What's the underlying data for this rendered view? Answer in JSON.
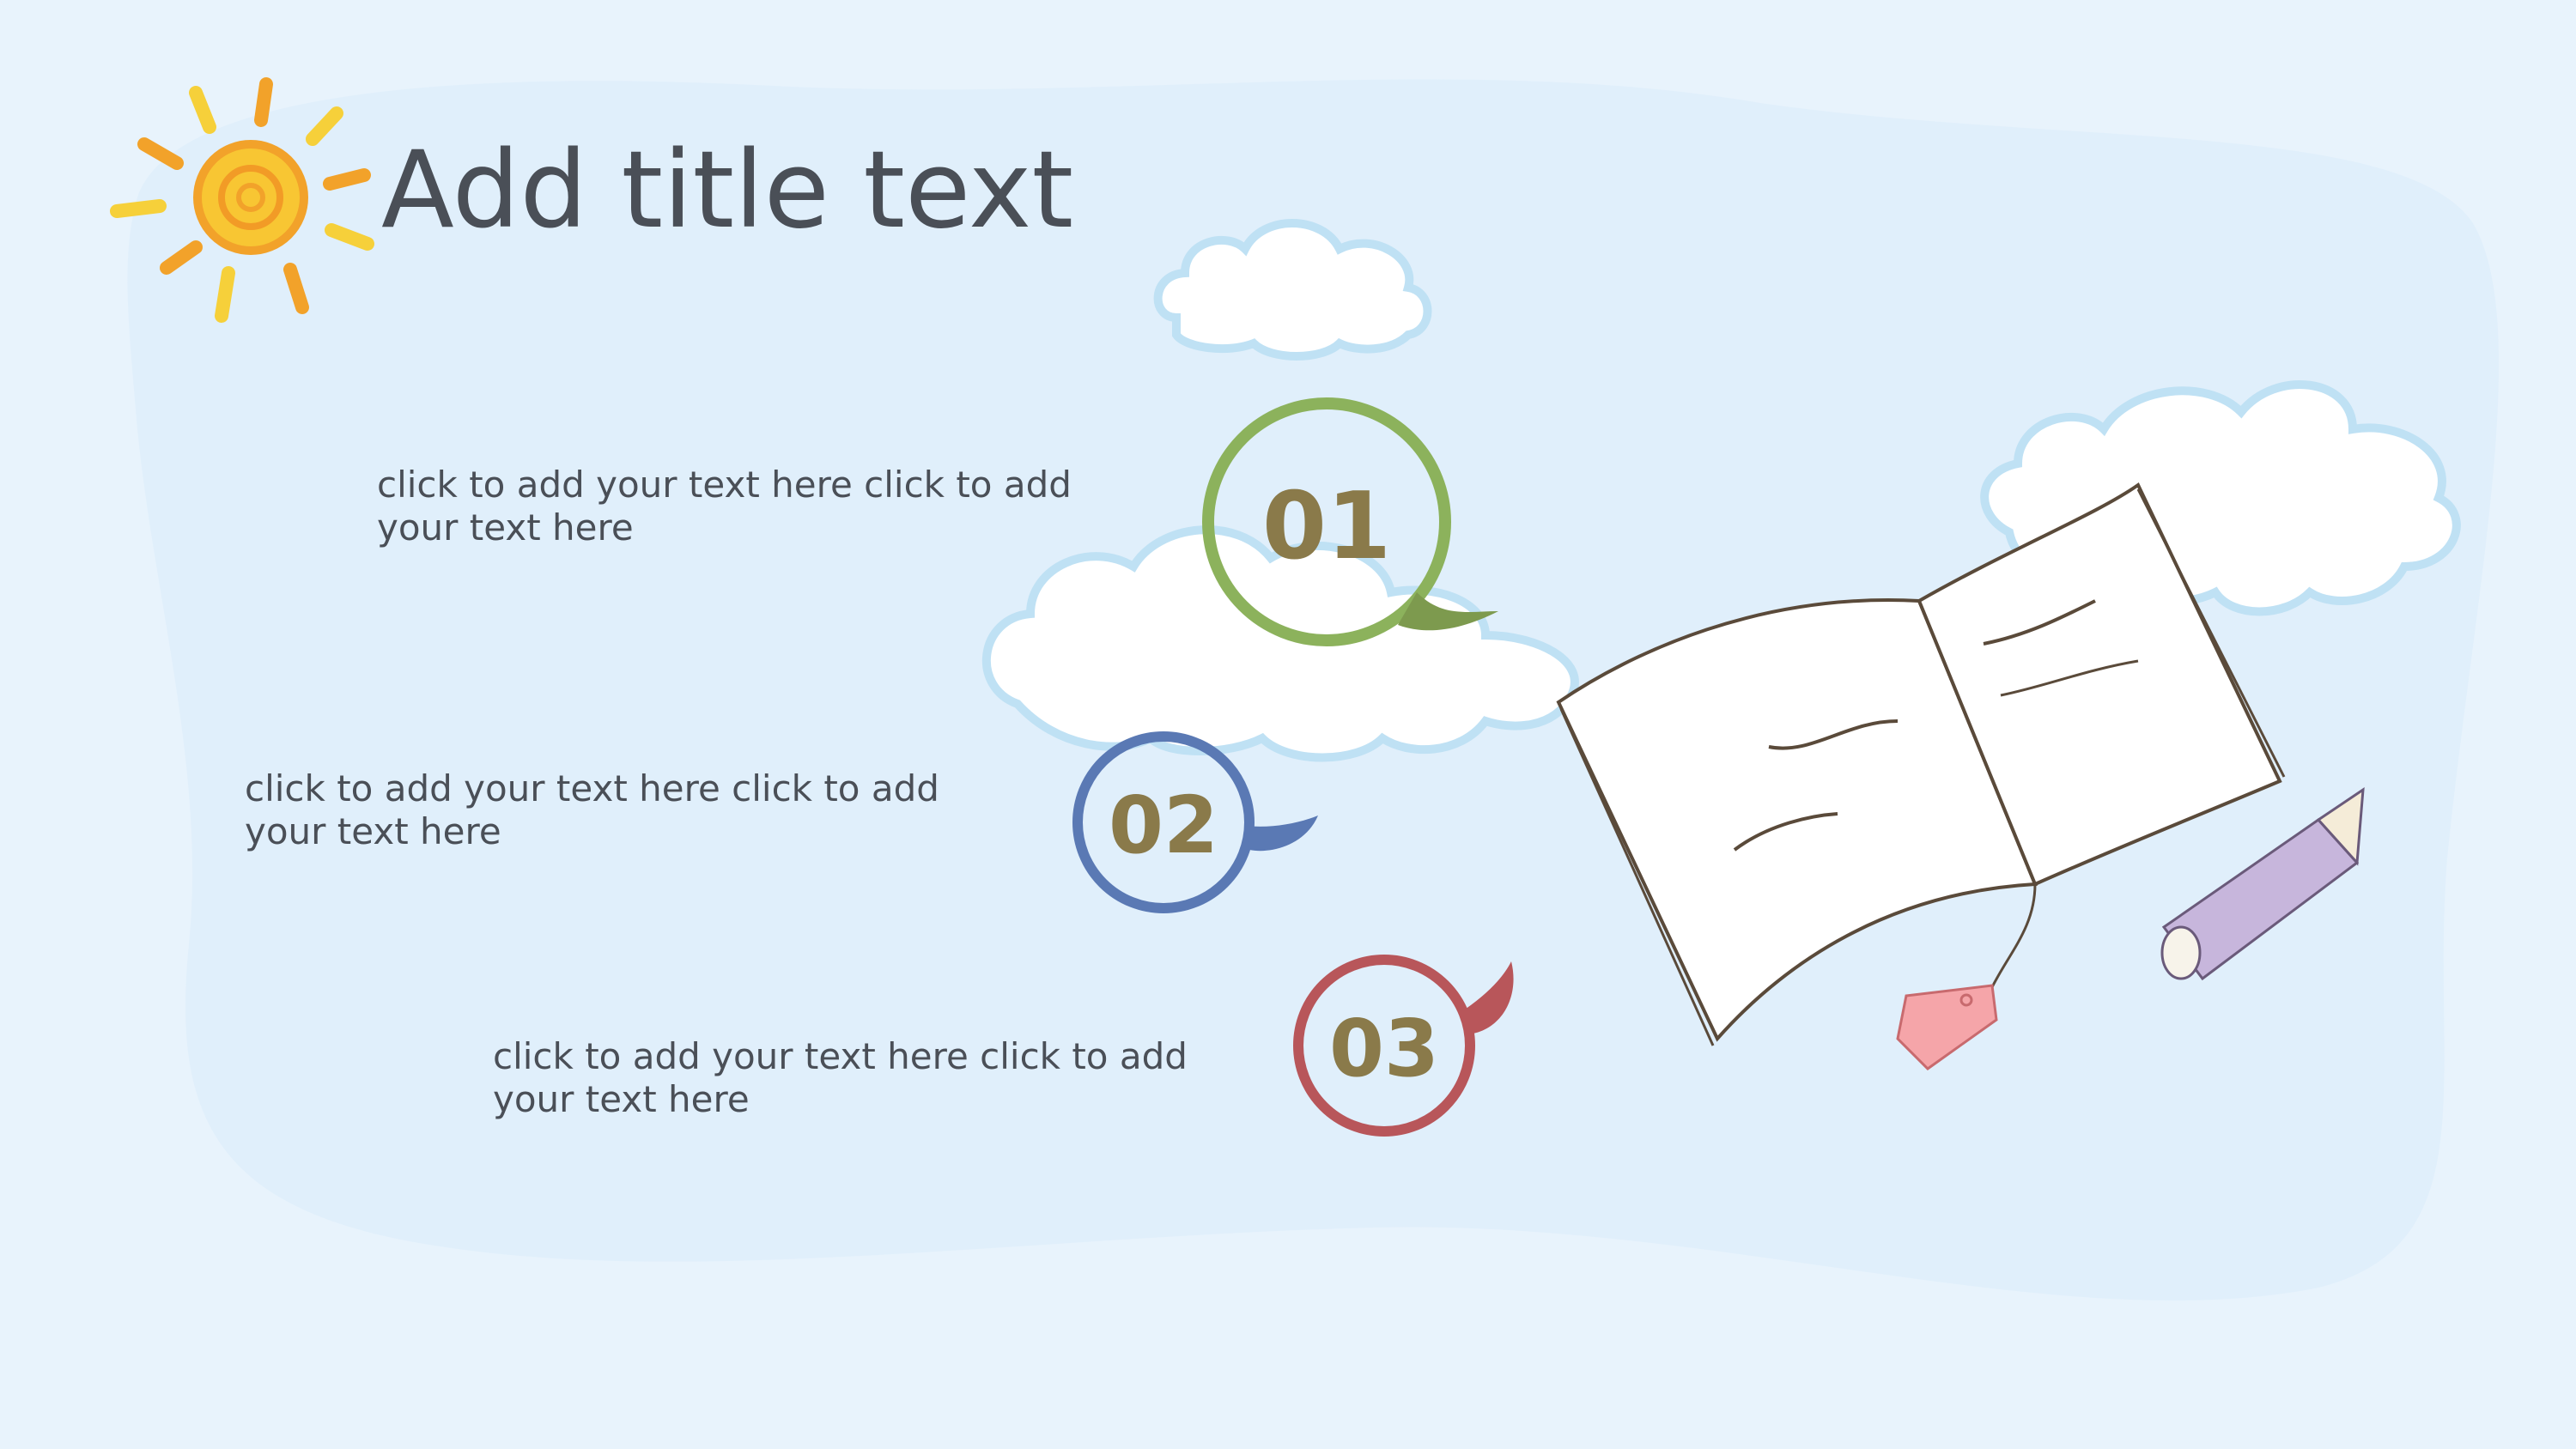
{
  "slide": {
    "title": "Add title text",
    "items": [
      {
        "number": "01",
        "text": "click to add your text here click to add your text here",
        "ring_color": "#8cb25c"
      },
      {
        "number": "02",
        "text": "click to add your text here click to add your text here",
        "ring_color": "#5a79b4"
      },
      {
        "number": "03",
        "text": "click to add your text here click to add your text here",
        "ring_color": "#b8565a"
      }
    ],
    "number_color": "#8a7a4a",
    "background_color": "#e8f3fc"
  },
  "icons": {
    "sun": "sun-icon",
    "book": "open-book-icon",
    "pencil": "pencil-icon",
    "bookmark": "bookmark-tag-icon",
    "clouds": "cloud-icon"
  }
}
